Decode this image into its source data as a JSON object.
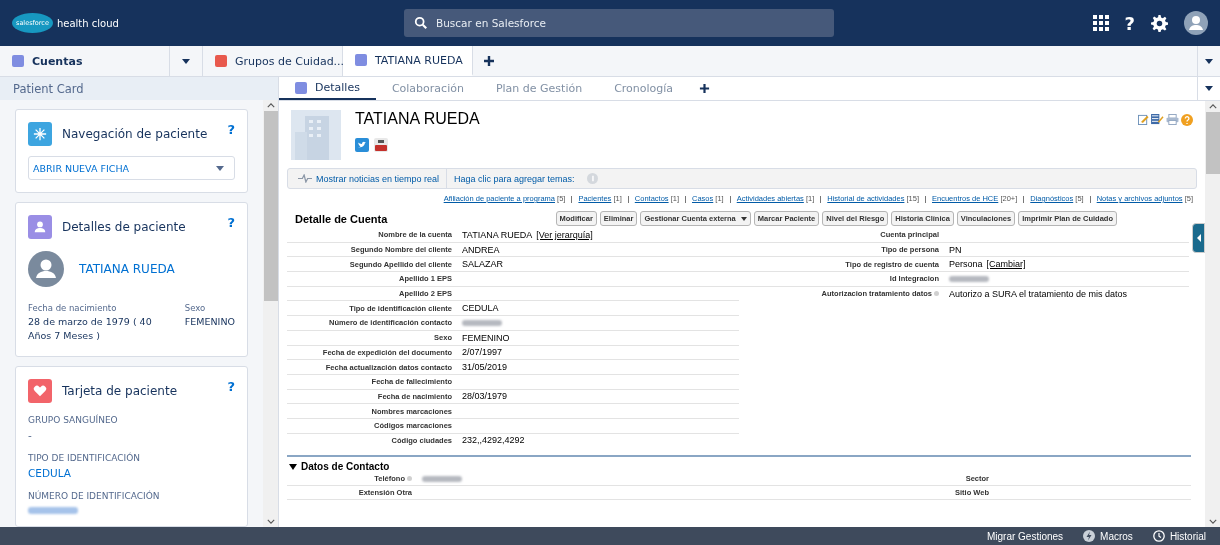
{
  "header": {
    "logo_badge": "salesforce",
    "logo_text": "health cloud",
    "search": {
      "placeholder": "Buscar en Salesforce"
    },
    "help": "?"
  },
  "tabs": [
    {
      "label": "Cuentas",
      "selected": false,
      "kind": "app"
    },
    {
      "label": "Grupos de Cuidad...",
      "selected": false,
      "kind": "group"
    },
    {
      "label": "TATIANA RUEDA",
      "selected": true,
      "kind": "record"
    }
  ],
  "subheader": {
    "title": "Patient Card"
  },
  "subtabs": [
    {
      "label": "Detalles",
      "selected": true
    },
    {
      "label": "Colaboración",
      "selected": false
    },
    {
      "label": "Plan de Gestión",
      "selected": false
    },
    {
      "label": "Cronología",
      "selected": false
    }
  ],
  "cards": [
    {
      "kind": "navigation",
      "title": "Navegación de paciente",
      "help": "?",
      "select": "ABRIR NUEVA FICHA"
    },
    {
      "kind": "details",
      "title": "Detalles de paciente",
      "help": "?",
      "name": "TATIANA RUEDA",
      "fields": [
        {
          "label": "Fecha de nacimiento",
          "value": "28 de marzo de 1979 ( 40 Años 7 Meses )"
        },
        {
          "label": "Sexo",
          "value": "FEMENINO"
        }
      ]
    },
    {
      "kind": "card",
      "title": "Tarjeta de paciente",
      "help": "?",
      "fields": [
        {
          "label": "GRUPO SANGUÍNEO",
          "value": "-"
        },
        {
          "label": "TIPO DE IDENTIFICACIÓN",
          "value": "CEDULA"
        },
        {
          "label": "NÚMERO DE IDENTIFICACIÓN",
          "redacted": true
        }
      ]
    }
  ],
  "record": {
    "title": "TATIANA RUEDA",
    "feed": {
      "news": "Mostrar noticias en tiempo real",
      "topics": "Haga clic para agregar temas:"
    },
    "related": [
      {
        "label": "Afiliación de paciente a programa",
        "count": "[5]"
      },
      {
        "label": "Pacientes",
        "count": "[1]"
      },
      {
        "label": "Contactos",
        "count": "[1]"
      },
      {
        "label": "Casos",
        "count": "[1]"
      },
      {
        "label": "Actividades abiertas",
        "count": "[1]"
      },
      {
        "label": "Historial de actividades",
        "count": "[15]"
      },
      {
        "label": "Encuentros de HCE",
        "count": "[20+]"
      },
      {
        "label": "Diagnósticos",
        "count": "[5]"
      },
      {
        "label": "Notas y archivos adjuntos",
        "count": "[5]"
      }
    ],
    "detail_title": "Detalle de Cuenta",
    "buttons": [
      {
        "label": "Modificar",
        "kind": "plain"
      },
      {
        "label": "Eliminar",
        "kind": "plain"
      },
      {
        "label": "Gestionar Cuenta externa",
        "kind": "menu"
      },
      {
        "label": "Marcar Paciente",
        "kind": "plain"
      },
      {
        "label": "Nivel del Riesgo",
        "kind": "plain"
      },
      {
        "label": "Historia Clínica",
        "kind": "plain"
      },
      {
        "label": "Vinculaciones",
        "kind": "plain"
      },
      {
        "label": "Imprimir Plan de Cuidado",
        "kind": "plain"
      }
    ],
    "left_fields": [
      {
        "label": "Nombre de la cuenta",
        "value": "TATIANA RUEDA",
        "link": "[Ver jerarquía]"
      },
      {
        "label": "Segundo Nombre del cliente",
        "value": "ANDREA"
      },
      {
        "label": "Segundo Apellido del cliente",
        "value": "SALAZAR"
      },
      {
        "label": "Apellido 1 EPS"
      },
      {
        "label": "Apellido 2 EPS"
      },
      {
        "label": "Tipo de identificación cliente",
        "value": "CEDULA"
      },
      {
        "label": "Número de identificación contacto",
        "redacted": true
      },
      {
        "label": "Sexo",
        "value": "FEMENINO"
      },
      {
        "label": "Fecha de expedición del documento",
        "value": "2/07/1997"
      },
      {
        "label": "Fecha actualización datos contacto",
        "value": "31/05/2019"
      },
      {
        "label": "Fecha de fallecimiento"
      },
      {
        "label": "Fecha de nacimiento",
        "value": "28/03/1979"
      },
      {
        "label": "Nombres marcaciones"
      },
      {
        "label": "Códigos marcaciones"
      },
      {
        "label": "Código ciudades",
        "value": "232,,4292,4292"
      }
    ],
    "right_fields": [
      {
        "label": "Cuenta principal"
      },
      {
        "label": "Tipo de persona",
        "value": "PN"
      },
      {
        "label": "Tipo de registro de cuenta",
        "value": "Persona",
        "link": "[Cambiar]"
      },
      {
        "label": "Id Integracion",
        "redacted": true
      },
      {
        "label": "Autorizacion tratamiento datos",
        "info": true,
        "value": "Autorizo a SURA el tratamiento de mis datos"
      }
    ],
    "contact": {
      "title": "Datos de Contacto",
      "expanded": true,
      "rows": [
        {
          "left": {
            "label": "Teléfono",
            "info": true,
            "redacted": true
          },
          "right": {
            "label": "Sector"
          }
        },
        {
          "left": {
            "label": "Extensión Otra"
          },
          "right": {
            "label": "Sitio Web"
          }
        }
      ]
    }
  },
  "footer": [
    {
      "label": "Migrar Gestiones",
      "kind": "text"
    },
    {
      "label": "Macros",
      "kind": "bolt"
    },
    {
      "label": "Historial",
      "kind": "clock"
    }
  ]
}
